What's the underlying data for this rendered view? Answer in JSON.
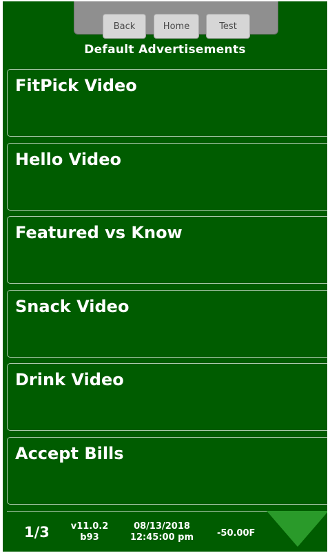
{
  "header": {
    "title": "Default Advertisements",
    "buttons": {
      "back": "Back",
      "home": "Home",
      "test": "Test"
    }
  },
  "list": {
    "items": [
      {
        "label": "FitPick Video"
      },
      {
        "label": "Hello Video"
      },
      {
        "label": "Featured vs Know"
      },
      {
        "label": "Snack Video"
      },
      {
        "label": "Drink Video"
      },
      {
        "label": "Accept Bills"
      }
    ]
  },
  "footer": {
    "page": "1/3",
    "version": "v11.0.2",
    "build": "b93",
    "date": "08/13/2018",
    "time": "12:45:00 pm",
    "temperature": "-50.00F",
    "next_icon": "triangle-down-icon"
  },
  "colors": {
    "background": "#005c00",
    "top_bar": "#8f8f8f",
    "button": "#d6d6d6",
    "item_border": "#a9c9a9",
    "arrow": "#2a9a2a",
    "text": "#ffffff"
  }
}
